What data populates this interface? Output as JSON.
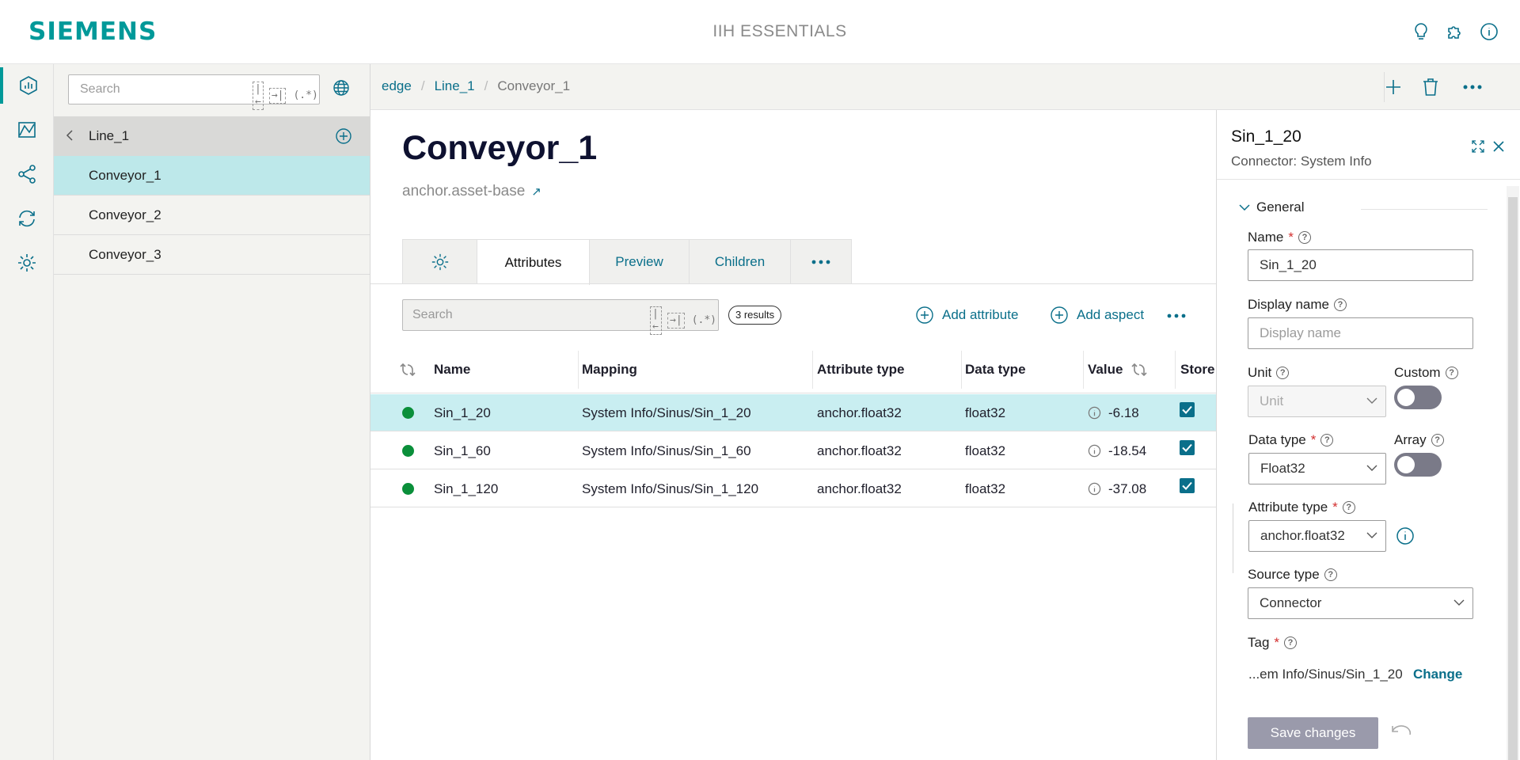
{
  "header": {
    "brand": "SIEMENS",
    "app_title": "IIH ESSENTIALS",
    "icons": [
      "lightbulb-icon",
      "puzzle-icon",
      "info-icon"
    ]
  },
  "rail": {
    "items": [
      "asset-model-icon",
      "dashboard-icon",
      "share-icon",
      "sync-icon",
      "settings-icon"
    ],
    "active": 0
  },
  "tree": {
    "search_placeholder": "Search",
    "search_toggles": [
      "|←",
      "→|",
      "(.*)"
    ],
    "parent": "Line_1",
    "items": [
      "Conveyor_1",
      "Conveyor_2",
      "Conveyor_3"
    ],
    "selected": 0
  },
  "breadcrumb": [
    "edge",
    "Line_1",
    "Conveyor_1"
  ],
  "asset": {
    "title": "Conveyor_1",
    "subtitle": "anchor.asset-base"
  },
  "tabs": [
    "Attributes",
    "Preview",
    "Children"
  ],
  "active_tab": "Attributes",
  "toolbar": {
    "search_placeholder": "Search",
    "search_toggles": [
      "|←",
      "→|",
      "(.*)"
    ],
    "results": "3 results",
    "add_attribute": "Add attribute",
    "add_aspect": "Add aspect"
  },
  "table": {
    "columns": [
      "Name",
      "Mapping",
      "Attribute type",
      "Data type",
      "Value",
      "Store"
    ],
    "rows": [
      {
        "name": "Sin_1_20",
        "mapping": "System Info/Sinus/Sin_1_20",
        "attr_type": "anchor.float32",
        "data_type": "float32",
        "value": "-6.18",
        "stored": true
      },
      {
        "name": "Sin_1_60",
        "mapping": "System Info/Sinus/Sin_1_60",
        "attr_type": "anchor.float32",
        "data_type": "float32",
        "value": "-18.54",
        "stored": true
      },
      {
        "name": "Sin_1_120",
        "mapping": "System Info/Sinus/Sin_1_120",
        "attr_type": "anchor.float32",
        "data_type": "float32",
        "value": "-37.08",
        "stored": true
      }
    ]
  },
  "panel": {
    "title": "Sin_1_20",
    "subtitle": "Connector: System Info",
    "section": "General",
    "name_label": "Name",
    "name_value": "Sin_1_20",
    "display_name_label": "Display name",
    "display_name_placeholder": "Display name",
    "unit_label": "Unit",
    "unit_placeholder": "Unit",
    "custom_label": "Custom",
    "data_type_label": "Data type",
    "data_type_value": "Float32",
    "array_label": "Array",
    "attr_type_label": "Attribute type",
    "attr_type_value": "anchor.float32",
    "source_type_label": "Source type",
    "source_type_value": "Connector",
    "tag_label": "Tag",
    "tag_value": "...em Info/Sinus/Sin_1_20",
    "change_label": "Change",
    "save_label": "Save changes",
    "help_glyph": "?",
    "required_glyph": "*"
  },
  "colors": {
    "accent": "#009999",
    "link": "#0a6f8a",
    "selected_row": "#c9eef1",
    "status_green": "#0a8f3a"
  }
}
